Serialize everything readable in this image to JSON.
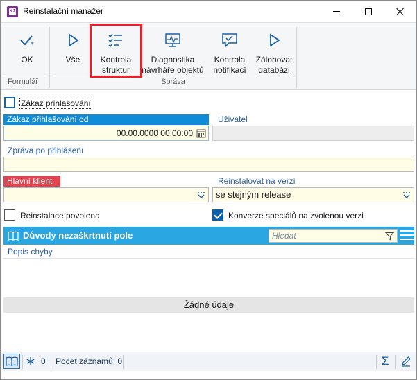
{
  "window": {
    "title": "Reinstalační manažer",
    "app_icon_text": "K2"
  },
  "ribbon": {
    "buttons": [
      {
        "label": "OK",
        "icon": "check-star-icon"
      },
      {
        "label": "Vše",
        "icon": "play-icon"
      },
      {
        "label": "Kontrola\nstruktur",
        "icon": "checklist-icon"
      },
      {
        "label": "Diagnostika\nnávrháře objektů",
        "icon": "monitor-pulse-icon"
      },
      {
        "label": "Kontrola\nnotifikací",
        "icon": "chat-check-icon"
      },
      {
        "label": "Zálohovat\ndatabázi",
        "icon": "play-icon"
      }
    ],
    "groups": {
      "formular": "Formulář",
      "sprava": "Správa"
    }
  },
  "form": {
    "login_ban": {
      "label": "Zákaz přihlašování",
      "checked": false
    },
    "login_ban_from": {
      "label": "Zákaz přihlašování od",
      "value": "00.00.0000 00:00:00"
    },
    "user": {
      "label": "Uživatel",
      "value": ""
    },
    "message": {
      "label": "Zpráva po přihlášení",
      "value": ""
    },
    "main_client": {
      "label": "Hlavní klient",
      "value": ""
    },
    "reinstall_version": {
      "label": "Reinstalovat na verzi",
      "value": "se stejným release"
    },
    "install_allowed": {
      "label": "Reinstalace povolena",
      "checked": false
    },
    "convert_specials": {
      "label": "Konverze speciálů na zvolenou verzi",
      "checked": true
    }
  },
  "grid": {
    "title": "Důvody nezaškrtnutí pole",
    "search_placeholder": "Hledat",
    "columns": [
      "Popis chyby"
    ],
    "empty_text": "Žádné údaje"
  },
  "statusbar": {
    "count_value": "0",
    "records_label": "Počet záznamů: 0"
  },
  "colors": {
    "accent": "#2aa6e2",
    "required_label": "#0f8bd8",
    "error_label": "#e3424f",
    "highlight": "#e8202b",
    "field_bg": "#fffde6"
  }
}
